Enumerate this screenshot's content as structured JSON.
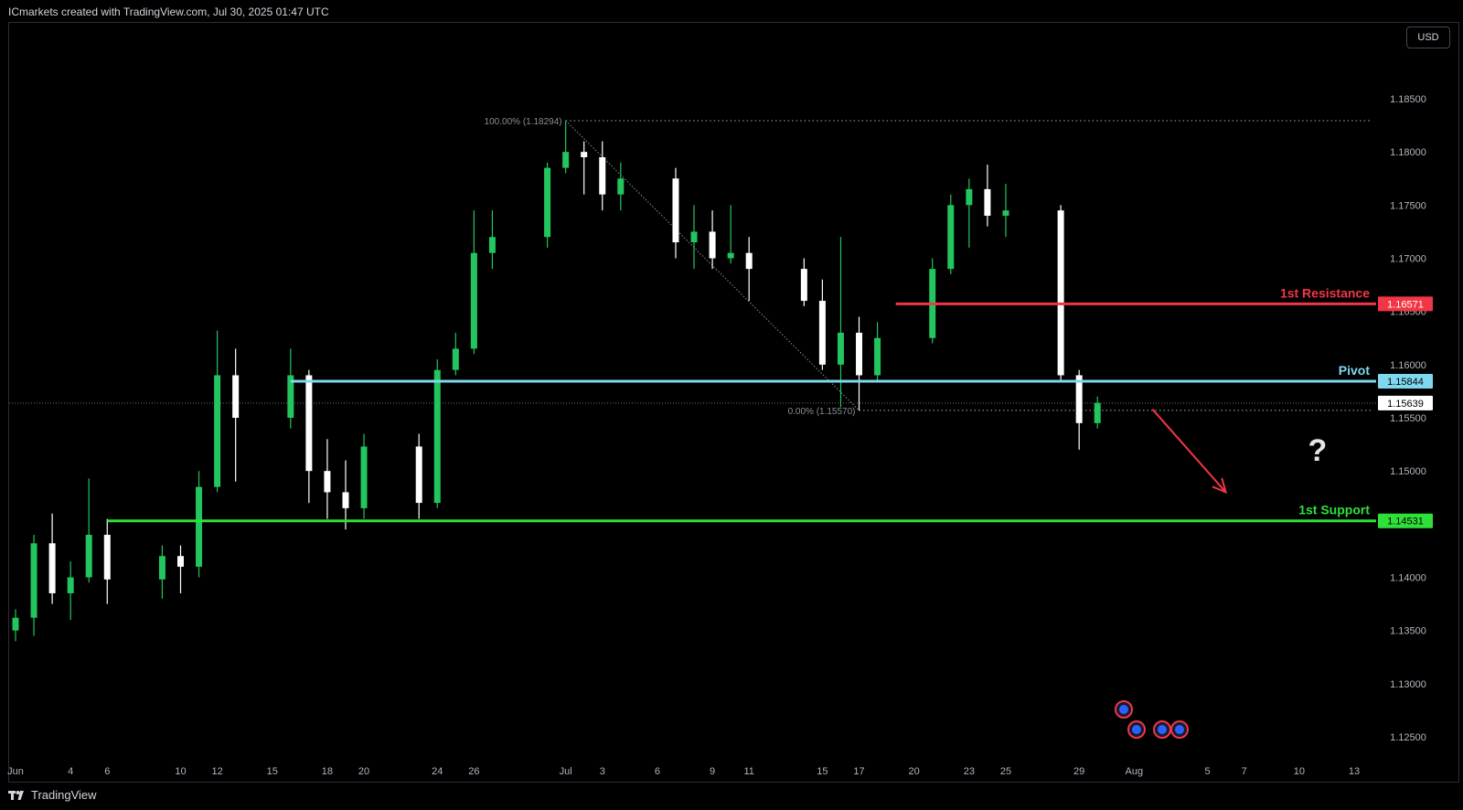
{
  "header": {
    "credit": "ICmarkets created with TradingView.com, Jul 30, 2025 01:47 UTC"
  },
  "toolbar": {
    "currency_label": "USD"
  },
  "footer": {
    "brand": "TradingView"
  },
  "colors": {
    "background": "#000000",
    "bull_candle": "#22c55e",
    "bear_candle": "#ffffff",
    "resistance": "#f23645",
    "pivot": "#7fd8ee",
    "support": "#2fe03a",
    "arrow": "#f23645"
  },
  "chart_data": {
    "type": "candlestick",
    "instrument": "EURUSD (D)",
    "y_axis": {
      "ticks": [
        "1.18500",
        "1.18000",
        "1.17500",
        "1.17000",
        "1.16500",
        "1.16000",
        "1.15500",
        "1.15000",
        "1.14500",
        "1.14000",
        "1.13500",
        "1.13000",
        "1.12500"
      ],
      "range": [
        1.1225,
        1.1885
      ]
    },
    "x_axis": {
      "ticks": [
        {
          "label": "Jun",
          "date": "2025-06-01"
        },
        {
          "label": "4",
          "date": "2025-06-04"
        },
        {
          "label": "6",
          "date": "2025-06-06"
        },
        {
          "label": "10",
          "date": "2025-06-10"
        },
        {
          "label": "12",
          "date": "2025-06-12"
        },
        {
          "label": "15",
          "date": "2025-06-15"
        },
        {
          "label": "18",
          "date": "2025-06-18"
        },
        {
          "label": "20",
          "date": "2025-06-20"
        },
        {
          "label": "24",
          "date": "2025-06-24"
        },
        {
          "label": "26",
          "date": "2025-06-26"
        },
        {
          "label": "Jul",
          "date": "2025-07-01"
        },
        {
          "label": "3",
          "date": "2025-07-03"
        },
        {
          "label": "6",
          "date": "2025-07-06"
        },
        {
          "label": "9",
          "date": "2025-07-09"
        },
        {
          "label": "11",
          "date": "2025-07-11"
        },
        {
          "label": "15",
          "date": "2025-07-15"
        },
        {
          "label": "17",
          "date": "2025-07-17"
        },
        {
          "label": "20",
          "date": "2025-07-20"
        },
        {
          "label": "23",
          "date": "2025-07-23"
        },
        {
          "label": "25",
          "date": "2025-07-25"
        },
        {
          "label": "29",
          "date": "2025-07-29"
        },
        {
          "label": "Aug",
          "date": "2025-08-01"
        },
        {
          "label": "5",
          "date": "2025-08-05"
        },
        {
          "label": "7",
          "date": "2025-08-07"
        },
        {
          "label": "10",
          "date": "2025-08-10"
        },
        {
          "label": "13",
          "date": "2025-08-13"
        }
      ]
    },
    "current_price": "1.15639",
    "current_price_value": 1.15639,
    "levels": [
      {
        "name": "1st Resistance",
        "value": 1.16571,
        "label": "1.16571",
        "start_date": "2025-07-19",
        "color": "#f23645"
      },
      {
        "name": "Pivot",
        "value": 1.15844,
        "label": "1.15844",
        "start_date": "2025-06-16",
        "color": "#7fd8ee"
      },
      {
        "name": "1st Support",
        "value": 1.14531,
        "label": "1.14531",
        "start_date": "2025-06-06",
        "color": "#2fe03a"
      }
    ],
    "fibonacci": [
      {
        "label": "100.00% (1.18294)",
        "value": 1.18294,
        "start_date": "2025-07-01"
      },
      {
        "label": "0.00% (1.15570)",
        "value": 1.1557,
        "start_date": "2025-07-17"
      }
    ],
    "fib_trendline": {
      "from_date": "2025-07-01",
      "from_value": 1.18294,
      "to_date": "2025-07-17",
      "to_value": 1.1557
    },
    "projection_arrow": {
      "from_date": "2025-08-02",
      "from_value": 1.1558,
      "to_date": "2025-08-06",
      "to_value": 1.148
    },
    "annotation_text": "?",
    "annotation_date": "2025-08-11",
    "annotation_value": 1.152,
    "events": [
      {
        "date": "2025-07-30",
        "value": 1.129
      },
      {
        "date": "2025-07-30",
        "value": 1.1267
      },
      {
        "date": "2025-07-30",
        "value": 1.1267
      },
      {
        "date": "2025-07-31",
        "value": 1.1267
      }
    ],
    "candles": [
      {
        "date": "2025-06-01",
        "o": 1.135,
        "h": 1.137,
        "l": 1.134,
        "c": 1.1362
      },
      {
        "date": "2025-06-02",
        "o": 1.1362,
        "h": 1.144,
        "l": 1.1345,
        "c": 1.1432
      },
      {
        "date": "2025-06-03",
        "o": 1.1432,
        "h": 1.146,
        "l": 1.1375,
        "c": 1.1385
      },
      {
        "date": "2025-06-04",
        "o": 1.1385,
        "h": 1.1415,
        "l": 1.136,
        "c": 1.14
      },
      {
        "date": "2025-06-05",
        "o": 1.14,
        "h": 1.1493,
        "l": 1.1395,
        "c": 1.144
      },
      {
        "date": "2025-06-06",
        "o": 1.144,
        "h": 1.1455,
        "l": 1.1375,
        "c": 1.1398
      },
      {
        "date": "2025-06-09",
        "o": 1.1398,
        "h": 1.143,
        "l": 1.138,
        "c": 1.142
      },
      {
        "date": "2025-06-10",
        "o": 1.142,
        "h": 1.143,
        "l": 1.1385,
        "c": 1.141
      },
      {
        "date": "2025-06-11",
        "o": 1.141,
        "h": 1.15,
        "l": 1.14,
        "c": 1.1485
      },
      {
        "date": "2025-06-12",
        "o": 1.1485,
        "h": 1.1632,
        "l": 1.148,
        "c": 1.159
      },
      {
        "date": "2025-06-13",
        "o": 1.159,
        "h": 1.1615,
        "l": 1.149,
        "c": 1.155
      },
      {
        "date": "2025-06-16",
        "o": 1.155,
        "h": 1.1615,
        "l": 1.154,
        "c": 1.159
      },
      {
        "date": "2025-06-17",
        "o": 1.159,
        "h": 1.1595,
        "l": 1.147,
        "c": 1.15
      },
      {
        "date": "2025-06-18",
        "o": 1.15,
        "h": 1.153,
        "l": 1.1455,
        "c": 1.148
      },
      {
        "date": "2025-06-19",
        "o": 1.148,
        "h": 1.151,
        "l": 1.1445,
        "c": 1.1465
      },
      {
        "date": "2025-06-20",
        "o": 1.1465,
        "h": 1.1535,
        "l": 1.1455,
        "c": 1.1523
      },
      {
        "date": "2025-06-23",
        "o": 1.1523,
        "h": 1.1535,
        "l": 1.1455,
        "c": 1.147
      },
      {
        "date": "2025-06-24",
        "o": 1.147,
        "h": 1.1605,
        "l": 1.1465,
        "c": 1.1595
      },
      {
        "date": "2025-06-25",
        "o": 1.1595,
        "h": 1.163,
        "l": 1.159,
        "c": 1.1615
      },
      {
        "date": "2025-06-26",
        "o": 1.1615,
        "h": 1.1745,
        "l": 1.161,
        "c": 1.1705
      },
      {
        "date": "2025-06-27",
        "o": 1.1705,
        "h": 1.1745,
        "l": 1.169,
        "c": 1.172
      },
      {
        "date": "2025-06-30",
        "o": 1.172,
        "h": 1.179,
        "l": 1.171,
        "c": 1.1785
      },
      {
        "date": "2025-07-01",
        "o": 1.1785,
        "h": 1.1829,
        "l": 1.178,
        "c": 1.18
      },
      {
        "date": "2025-07-02",
        "o": 1.18,
        "h": 1.181,
        "l": 1.176,
        "c": 1.1795
      },
      {
        "date": "2025-07-03",
        "o": 1.1795,
        "h": 1.181,
        "l": 1.1745,
        "c": 1.176
      },
      {
        "date": "2025-07-04",
        "o": 1.176,
        "h": 1.179,
        "l": 1.1745,
        "c": 1.1775
      },
      {
        "date": "2025-07-07",
        "o": 1.1775,
        "h": 1.1785,
        "l": 1.17,
        "c": 1.1715
      },
      {
        "date": "2025-07-08",
        "o": 1.1715,
        "h": 1.175,
        "l": 1.169,
        "c": 1.1725
      },
      {
        "date": "2025-07-09",
        "o": 1.1725,
        "h": 1.1745,
        "l": 1.169,
        "c": 1.17
      },
      {
        "date": "2025-07-10",
        "o": 1.17,
        "h": 1.175,
        "l": 1.1695,
        "c": 1.1705
      },
      {
        "date": "2025-07-11",
        "o": 1.1705,
        "h": 1.172,
        "l": 1.166,
        "c": 1.169
      },
      {
        "date": "2025-07-14",
        "o": 1.169,
        "h": 1.17,
        "l": 1.1655,
        "c": 1.166
      },
      {
        "date": "2025-07-15",
        "o": 1.166,
        "h": 1.168,
        "l": 1.1595,
        "c": 1.16
      },
      {
        "date": "2025-07-16",
        "o": 1.16,
        "h": 1.172,
        "l": 1.156,
        "c": 1.163
      },
      {
        "date": "2025-07-17",
        "o": 1.163,
        "h": 1.1645,
        "l": 1.1557,
        "c": 1.159
      },
      {
        "date": "2025-07-18",
        "o": 1.159,
        "h": 1.164,
        "l": 1.1585,
        "c": 1.1625
      },
      {
        "date": "2025-07-21",
        "o": 1.1625,
        "h": 1.17,
        "l": 1.162,
        "c": 1.169
      },
      {
        "date": "2025-07-22",
        "o": 1.169,
        "h": 1.176,
        "l": 1.1685,
        "c": 1.175
      },
      {
        "date": "2025-07-23",
        "o": 1.175,
        "h": 1.1775,
        "l": 1.171,
        "c": 1.1765
      },
      {
        "date": "2025-07-24",
        "o": 1.1765,
        "h": 1.1788,
        "l": 1.173,
        "c": 1.174
      },
      {
        "date": "2025-07-25",
        "o": 1.174,
        "h": 1.177,
        "l": 1.172,
        "c": 1.1745
      },
      {
        "date": "2025-07-28",
        "o": 1.1745,
        "h": 1.175,
        "l": 1.1585,
        "c": 1.159
      },
      {
        "date": "2025-07-29",
        "o": 1.159,
        "h": 1.1595,
        "l": 1.152,
        "c": 1.1545
      },
      {
        "date": "2025-07-30",
        "o": 1.1545,
        "h": 1.157,
        "l": 1.154,
        "c": 1.1564
      }
    ]
  }
}
